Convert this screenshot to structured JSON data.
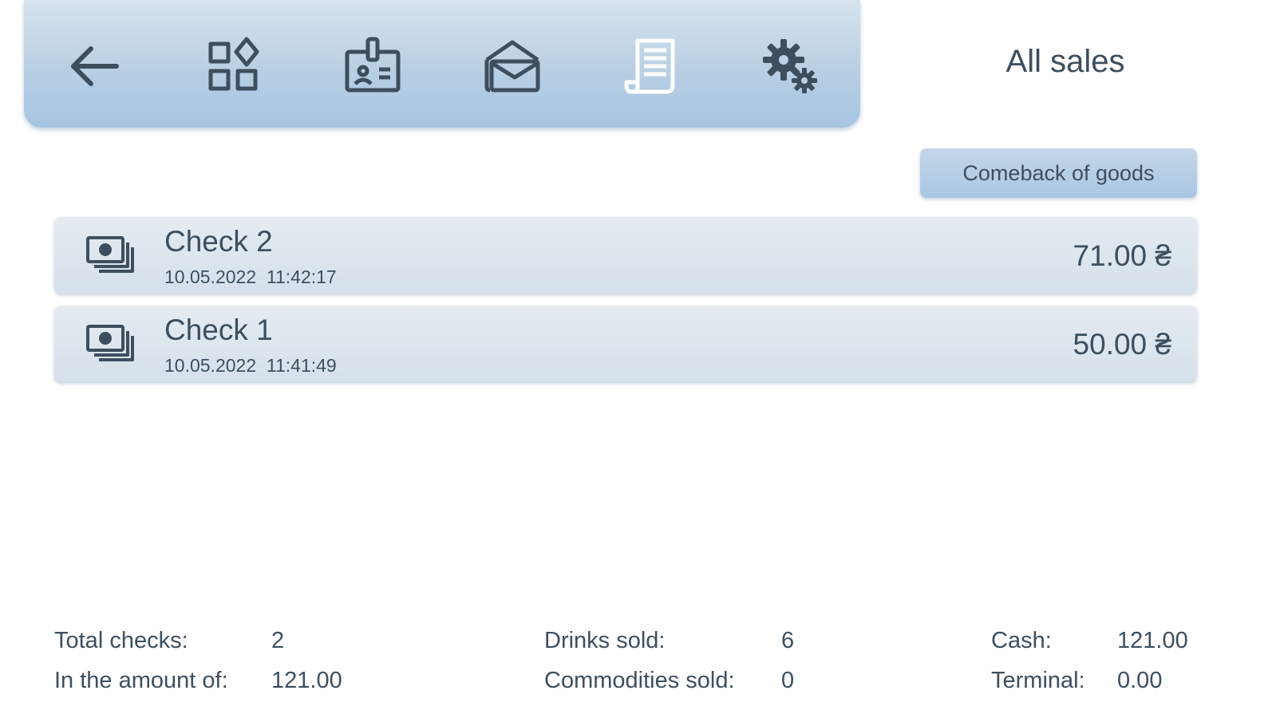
{
  "toolbar": {
    "buttons": [
      {
        "icon": "back-arrow-icon"
      },
      {
        "icon": "categories-icon"
      },
      {
        "icon": "id-badge-icon"
      },
      {
        "icon": "open-mail-icon"
      },
      {
        "icon": "receipt-icon",
        "active": true
      },
      {
        "icon": "settings-gears-icon"
      }
    ]
  },
  "page": {
    "title": "All sales"
  },
  "actions": {
    "comeback_label": "Comeback of goods"
  },
  "checks": [
    {
      "title": "Check 2",
      "datetime": "10.05.2022  11:42:17",
      "amount": "71.00 ₴"
    },
    {
      "title": "Check 1",
      "datetime": "10.05.2022  11:41:49",
      "amount": "50.00 ₴"
    }
  ],
  "summary": {
    "total_checks_label": "Total checks:",
    "total_checks_value": "2",
    "amount_label": "In the amount of:",
    "amount_value": "121.00",
    "drinks_label": "Drinks sold:",
    "drinks_value": "6",
    "commodities_label": "Commodities sold:",
    "commodities_value": "0",
    "cash_label": "Cash:",
    "cash_value": "121.00",
    "terminal_label": "Terminal:",
    "terminal_value": "0.00"
  },
  "colors": {
    "text": "#3d4f5f",
    "toolbar_top": "#d6e3ee",
    "toolbar_bottom": "#a6c5e2",
    "active_icon": "#ffffff"
  }
}
